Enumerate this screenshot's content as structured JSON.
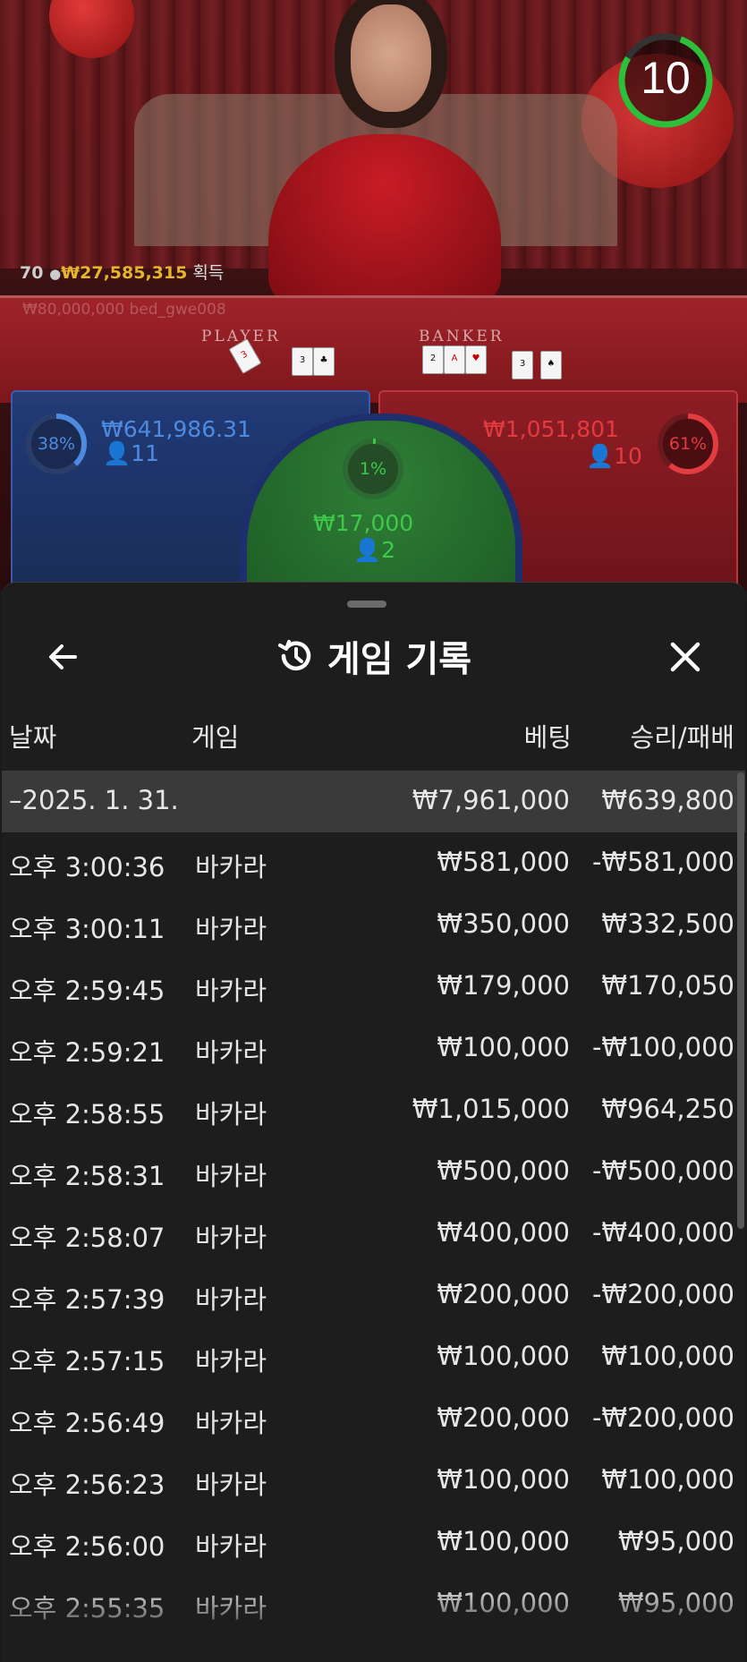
{
  "game_view": {
    "win_banner": {
      "count": "70",
      "amount": "₩27,585,315",
      "suffix": "획득"
    },
    "ghost_text": "₩80,000,000  bed_gwe008",
    "table_labels": {
      "player": "PLAYER",
      "banker": "BANKER"
    },
    "countdown": "10",
    "player_zone": {
      "percent": "38%",
      "amount": "₩641,986.31",
      "count": "11"
    },
    "tie_zone": {
      "percent": "1%",
      "amount": "₩17,000",
      "count": "2"
    },
    "banker_zone": {
      "percent": "61%",
      "amount": "₩1,051,801",
      "count": "10"
    }
  },
  "history_panel": {
    "title": "게임 기록",
    "icons": {
      "back": "arrow-left-icon",
      "history": "history-icon",
      "close": "close-icon"
    },
    "columns": {
      "date": "날짜",
      "game": "게임",
      "bet": "베팅",
      "result": "승리/패배"
    },
    "group": {
      "date": "–2025. 1. 31.",
      "bet": "₩7,961,000",
      "result": "₩639,800"
    },
    "rows": [
      {
        "time": "오후 3:00:36",
        "game": "바카라",
        "bet": "₩581,000",
        "result": "-₩581,000"
      },
      {
        "time": "오후 3:00:11",
        "game": "바카라",
        "bet": "₩350,000",
        "result": "₩332,500"
      },
      {
        "time": "오후 2:59:45",
        "game": "바카라",
        "bet": "₩179,000",
        "result": "₩170,050"
      },
      {
        "time": "오후 2:59:21",
        "game": "바카라",
        "bet": "₩100,000",
        "result": "-₩100,000"
      },
      {
        "time": "오후 2:58:55",
        "game": "바카라",
        "bet": "₩1,015,000",
        "result": "₩964,250"
      },
      {
        "time": "오후 2:58:31",
        "game": "바카라",
        "bet": "₩500,000",
        "result": "-₩500,000"
      },
      {
        "time": "오후 2:58:07",
        "game": "바카라",
        "bet": "₩400,000",
        "result": "-₩400,000"
      },
      {
        "time": "오후 2:57:39",
        "game": "바카라",
        "bet": "₩200,000",
        "result": "-₩200,000"
      },
      {
        "time": "오후 2:57:15",
        "game": "바카라",
        "bet": "₩100,000",
        "result": "₩100,000"
      },
      {
        "time": "오후 2:56:49",
        "game": "바카라",
        "bet": "₩200,000",
        "result": "-₩200,000"
      },
      {
        "time": "오후 2:56:23",
        "game": "바카라",
        "bet": "₩100,000",
        "result": "₩100,000"
      },
      {
        "time": "오후 2:56:00",
        "game": "바카라",
        "bet": "₩100,000",
        "result": "₩95,000"
      },
      {
        "time": "오후 2:55:35",
        "game": "바카라",
        "bet": "₩100,000",
        "result": "₩95,000"
      }
    ]
  },
  "colors": {
    "player_blue": "#4e8be0",
    "banker_red": "#e23b40",
    "tie_green": "#3ec94a",
    "win_gold": "#e6b52e",
    "panel_bg": "#1d1d1d",
    "group_row_bg": "#3a3a3a"
  }
}
